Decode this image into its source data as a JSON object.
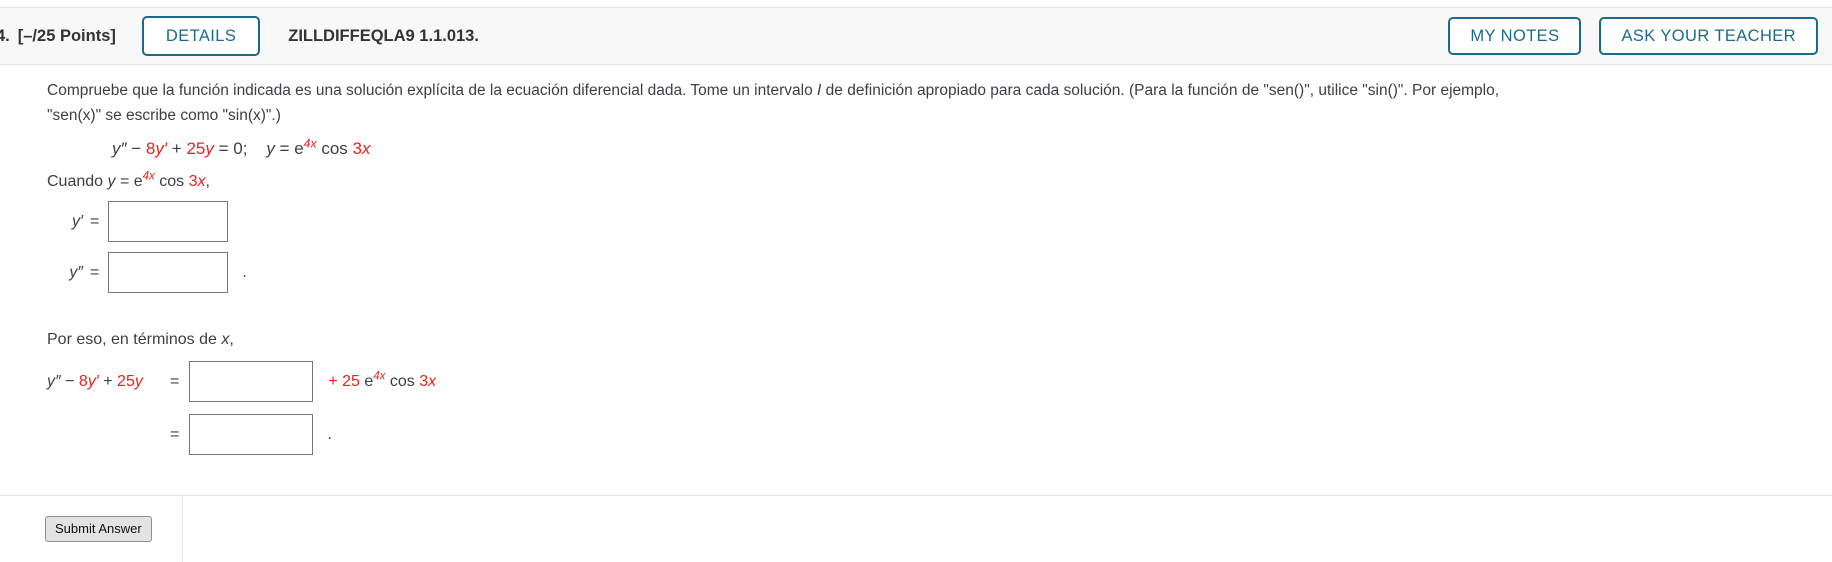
{
  "header": {
    "question_number": "4.",
    "points": "[–/25 Points]",
    "details_label": "DETAILS",
    "assignment_code": "ZILLDIFFEQLA9 1.1.013.",
    "my_notes_label": "MY NOTES",
    "ask_teacher_label": "ASK YOUR TEACHER"
  },
  "prompt": {
    "line1": "Compruebe que la función indicada es una solución explícita de la ecuación diferencial dada. Tome un intervalo ",
    "italic_I": "I",
    "line1_cont": " de definición apropiado para cada solución. (Para la función de \"sen()\", utilice \"sin()\". Por ejemplo,",
    "line2": "\"sen(x)\" se escribe como \"sin(x)\".)"
  },
  "given_equation": {
    "y_double_prime": "y″",
    "minus": " − ",
    "coef8": "8",
    "y_prime": "y′",
    "plus": " + ",
    "coef25": "25",
    "y": "y",
    "equals_zero": " = 0;",
    "solution_y": "y",
    "solution_eq": " = e",
    "exp_4x": "4x",
    "cos_text": " cos ",
    "coef3": "3",
    "var_x": "x"
  },
  "cuando": {
    "label": "Cuando ",
    "y": "y",
    "equals": " = e",
    "exp_4x": "4x",
    "cos_text": " cos ",
    "coef3": "3",
    "var_x": "x",
    "comma": ","
  },
  "inputs": {
    "y_prime_label": "y′",
    "y_prime_value": "",
    "y_double_prime_label": "y″",
    "y_double_prime_value": "",
    "equals": "=",
    "period": "."
  },
  "por_eso": {
    "text": "Por eso, en términos de ",
    "var_x": "x",
    "comma": ","
  },
  "final": {
    "lhs_y_double_prime": "y″",
    "lhs_minus": " − ",
    "lhs_coef8": "8",
    "lhs_y_prime": "y′",
    "lhs_plus": " + ",
    "lhs_coef25": "25",
    "lhs_y": "y",
    "equals": "=",
    "row1_value": "",
    "rhs_plus": "+ ",
    "rhs_coef25": "25",
    "rhs_e": " e",
    "rhs_exp_4x": "4x",
    "rhs_cos": " cos ",
    "rhs_coef3": "3",
    "rhs_x": "x",
    "row2_value": "",
    "period": "."
  },
  "footer": {
    "submit_label": "Submit Answer"
  },
  "colors": {
    "accent_blue": "#1b6a8c",
    "math_red": "#e8231f",
    "text": "#3c4043",
    "header_bg": "#f8f8f8",
    "border": "#e2e2e2"
  }
}
